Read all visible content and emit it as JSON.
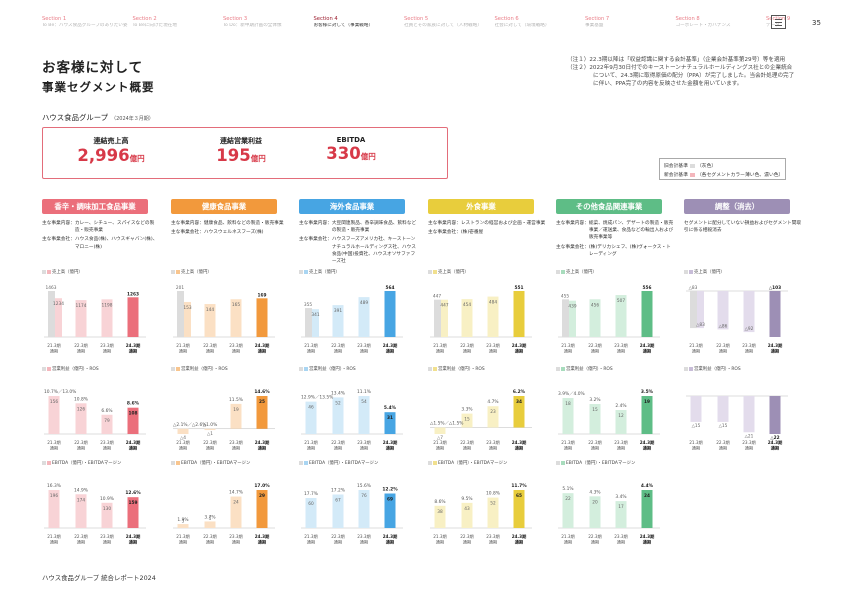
{
  "nav": [
    {
      "section": "Section 1",
      "subtitle": "To Be：ハウス食品グループのありたい姿"
    },
    {
      "section": "Section 2",
      "subtitle": "To Beに向けた現在地"
    },
    {
      "section": "Section 3",
      "subtitle": "To Do：新中期計画の全体像"
    },
    {
      "section": "Section 4",
      "subtitle": "お客様に対して（事業戦略）",
      "active": true
    },
    {
      "section": "Section 5",
      "subtitle": "社員とその家族に対して（人材戦略）"
    },
    {
      "section": "Section 6",
      "subtitle": "社会に対して（環境戦略）"
    },
    {
      "section": "Section 7",
      "subtitle": "事業基盤"
    },
    {
      "section": "Section 8",
      "subtitle": "コーポレート・ガバナンス"
    },
    {
      "section": "Section 9",
      "subtitle": "データ"
    }
  ],
  "page_number": "35",
  "title_line1": "お客様に対して",
  "title_line2": "事業セグメント概要",
  "notes": [
    "（注１）22.3期以降は「収益認識に関する会計基準」（企業会計基準第29号）等を適用",
    "（注２）2022年9月30日付でのキーストーンナチュラルホールディングス社との企業統合について、24.3期に取得原価の配分（PPA）が完了しました。当会計処理の完了に伴い、PPA完了の内容を反映させた金額を用いています。"
  ],
  "company": "ハウス食品グループ",
  "company_period": "（2024年３月期）",
  "kpis": [
    {
      "label": "連結売上高",
      "value": "2,996",
      "unit": "億円"
    },
    {
      "label": "連結営業利益",
      "value": "195",
      "unit": "億円"
    },
    {
      "label": "EBITDA",
      "value": "330",
      "unit": "億円"
    }
  ],
  "legend": {
    "row1_label": "旧会計基準",
    "row1_note": "（灰色）",
    "row2_label": "新会計基準",
    "row2_note": "（各セグメントカラー薄い色、濃い色）"
  },
  "colors": {
    "accent": "#d73948",
    "nav_section": "#e97c86",
    "gray_old_standard": "#dcdcdc"
  },
  "segments": [
    {
      "name": "香辛・調味加工食品事業",
      "color": "#eb6f7b",
      "light": "#f8d3d6",
      "mid": "#f4b6bc",
      "desc": [
        {
          "k": "主な事業内容：",
          "v": "カレー、シチュー、スパイスなどの製造・販売事業"
        },
        {
          "k": "主な事業会社：",
          "v": "ハウス食品(株)、ハウスギャバン(株)、マロニー(株)"
        }
      ],
      "sales": {
        "label": "売上高（億円）",
        "values": [
          1463,
          1234,
          1174,
          1198,
          1263
        ]
      },
      "op": {
        "label": "営業利益（億円）・ROS",
        "values": [
          156,
          126,
          79,
          108
        ],
        "ros": [
          "10.7%／13.0%",
          "10.8%",
          "6.6%",
          "8.6%"
        ]
      },
      "ebitda": {
        "label": "EBITDA（億円）・EBITDAマージン",
        "values": [
          196,
          174,
          130,
          159
        ],
        "margins": [
          "16.3%",
          "14.9%",
          "10.9%",
          "12.6%"
        ]
      }
    },
    {
      "name": "健康食品事業",
      "color": "#f2993c",
      "light": "#fbe0c4",
      "mid": "#f8c58e",
      "desc": [
        {
          "k": "主な事業内容：",
          "v": "健康食品、飲料などの製造・販売事業"
        },
        {
          "k": "主な事業会社：",
          "v": "ハウスウェルネスフーズ(株)"
        }
      ],
      "sales": {
        "label": "売上高（億円）",
        "values": [
          201,
          153,
          144,
          165,
          169
        ]
      },
      "op": {
        "label": "営業利益（億円）・ROS",
        "values": [
          -4,
          -1,
          19,
          25
        ],
        "ros": [
          "△2.1%／△2.6%",
          "△1.0%",
          "11.5%",
          "14.6%"
        ]
      },
      "ebitda": {
        "label": "EBITDA（億円）・EBITDAマージン",
        "values": [
          3,
          5,
          24,
          29
        ],
        "margins": [
          "1.9%",
          "3.7%",
          "14.7%",
          "17.0%"
        ]
      }
    },
    {
      "name": "海外食品事業",
      "color": "#47a5e3",
      "light": "#d3eaf8",
      "mid": "#a9d5f2",
      "desc": [
        {
          "k": "主な事業内容：",
          "v": "大豆関連製品、香辛調味食品、飲料などの製造・販売事業"
        },
        {
          "k": "主な事業会社：",
          "v": "ハウスフーズアメリカ社、キーストーンナチュラルホールディングス社、ハウス食品(中国)投資社、ハウスオソサファフーズ社"
        }
      ],
      "sales": {
        "label": "売上高（億円）",
        "values": [
          355,
          341,
          391,
          489,
          564
        ]
      },
      "op": {
        "label": "営業利益（億円）・ROS",
        "values": [
          46,
          52,
          54,
          31
        ],
        "ros": [
          "12.9%／13.5%",
          "13.4%",
          "11.1%",
          "5.4%"
        ]
      },
      "ebitda": {
        "label": "EBITDA（億円）・EBITDAマージン",
        "values": [
          60,
          67,
          76,
          69
        ],
        "margins": [
          "17.7%",
          "17.2%",
          "15.6%",
          "12.2%"
        ]
      }
    },
    {
      "name": "外食事業",
      "color": "#e8cd3c",
      "light": "#f8f0c4",
      "mid": "#f1e08e",
      "desc": [
        {
          "k": "主な事業内容：",
          "v": "レストランの経営および企画・運営事業"
        },
        {
          "k": "主な事業会社：",
          "v": "(株)壱番屋"
        }
      ],
      "sales": {
        "label": "売上高（億円）",
        "values": [
          447,
          447,
          454,
          484,
          551
        ]
      },
      "op": {
        "label": "営業利益（億円）・ROS",
        "values": [
          -7,
          15,
          23,
          34
        ],
        "ros": [
          "△1.5%／△1.5%",
          "3.3%",
          "4.7%",
          "6.2%"
        ]
      },
      "ebitda": {
        "label": "EBITDA（億円）・EBITDAマージン",
        "values": [
          38,
          43,
          52,
          65
        ],
        "margins": [
          "8.6%",
          "9.5%",
          "10.8%",
          "11.7%"
        ]
      }
    },
    {
      "name": "その他食品関連事業",
      "color": "#5ebd86",
      "light": "#d3eedd",
      "mid": "#a8dcbd",
      "desc": [
        {
          "k": "主な事業内容：",
          "v": "総菜、焼成パン、デザートの製造・販売事業／運送業、食品などの輸出入および販売事業等"
        },
        {
          "k": "主な事業会社：",
          "v": "(株)デリカシェフ、(株)ヴォークス・トレーディング"
        }
      ],
      "sales": {
        "label": "売上高（億円）",
        "values": [
          455,
          439,
          456,
          507,
          556
        ]
      },
      "op": {
        "label": "営業利益（億円）・ROS",
        "values": [
          18,
          15,
          12,
          19
        ],
        "ros": [
          "3.9%／4.0%",
          "3.2%",
          "2.4%",
          "3.5%"
        ]
      },
      "ebitda": {
        "label": "EBITDA（億円）・EBITDAマージン",
        "values": [
          22,
          20,
          17,
          24
        ],
        "margins": [
          "5.1%",
          "4.3%",
          "3.4%",
          "4.4%"
        ]
      }
    },
    {
      "name": "調整（消去）",
      "color": "#9d8fb5",
      "light": "#e3dcec",
      "mid": "#c8bdd8",
      "desc": [
        {
          "k": "",
          "v": "セグメントに配分していない損益およびセグメント間取引に係る相殺消去"
        }
      ],
      "sales": {
        "label": "売上高（億円）",
        "values": [
          -83,
          -83,
          -86,
          -92,
          -103
        ]
      },
      "op": {
        "label": "営業利益（億円）・ROS",
        "values": [
          -15,
          -15,
          -21,
          -22
        ],
        "ros": [
          "",
          "",
          "",
          ""
        ]
      },
      "ebitda": null
    }
  ],
  "axis": {
    "sales_years": [
      "21.3期\n通期",
      "22.3期\n通期",
      "23.3期\n通期",
      "24.3期\n通期"
    ],
    "years": [
      "21.3期\n通期",
      "22.3期\n通期",
      "23.3期\n通期",
      "24.3期\n通期"
    ]
  },
  "footer": "ハウス食品グループ 統合レポート2024"
}
